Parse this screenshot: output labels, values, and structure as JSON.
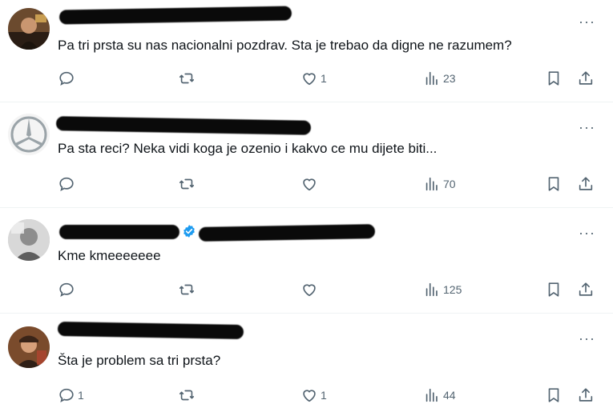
{
  "tweets": [
    {
      "text": "Pa tri prsta su nas nacionalni pozdrav. Sta je trebao da digne ne razumem?",
      "reply_count": "",
      "retweet_count": "",
      "like_count": "1",
      "view_count": "23"
    },
    {
      "text": "Pa sta reci? Neka vidi koga je ozenio i kakvo ce mu dijete biti...",
      "reply_count": "",
      "retweet_count": "",
      "like_count": "",
      "view_count": "70"
    },
    {
      "text": "Kme kmeeeeeee",
      "reply_count": "",
      "retweet_count": "",
      "like_count": "",
      "view_count": "125"
    },
    {
      "text": "Šta je problem sa tri prsta?",
      "reply_count": "1",
      "retweet_count": "",
      "like_count": "1",
      "view_count": "44"
    }
  ],
  "icons": {
    "reply": "reply-icon",
    "retweet": "retweet-icon",
    "like": "heart-icon",
    "views": "views-icon",
    "bookmark": "bookmark-icon",
    "share": "share-icon",
    "more": "more-dots-icon",
    "verified": "verified-badge-icon"
  },
  "more_label": "···",
  "colors": {
    "icon_gray": "#536471",
    "text": "#0f1419",
    "divider": "#eff3f4",
    "verified_blue": "#1d9bf0"
  }
}
